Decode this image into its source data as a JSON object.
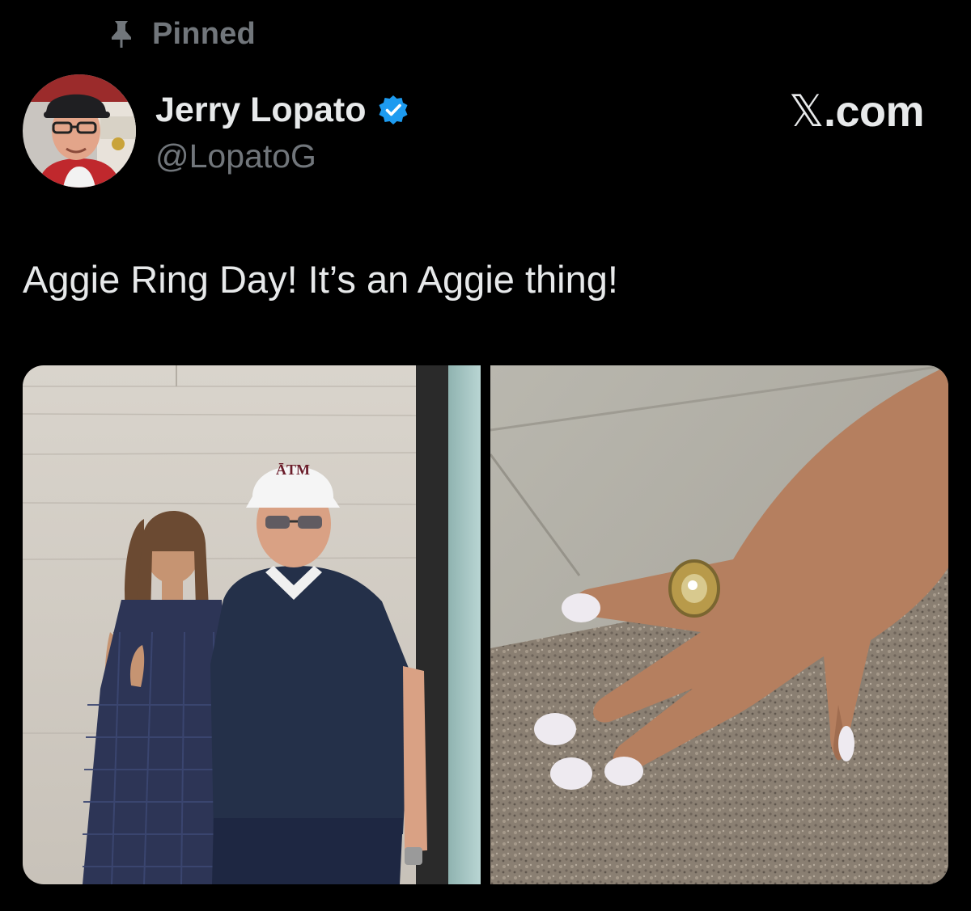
{
  "pinned": {
    "label": "Pinned",
    "icon": "pin-icon"
  },
  "author": {
    "name": "Jerry Lopato",
    "handle": "@LopatoG",
    "verified": true,
    "verified_icon": "verified-badge-icon",
    "verified_color": "#1d9bf0"
  },
  "site": {
    "brand_mark": "𝕏",
    "brand_suffix": ".com"
  },
  "post": {
    "text": "Aggie Ring Day! It’s an Aggie thing!"
  },
  "media": {
    "photos": [
      {
        "cap_text": "ĀTM"
      },
      {}
    ]
  },
  "colors": {
    "background": "#000000",
    "primary_text": "#e7e9ea",
    "secondary_text": "#71767b"
  }
}
